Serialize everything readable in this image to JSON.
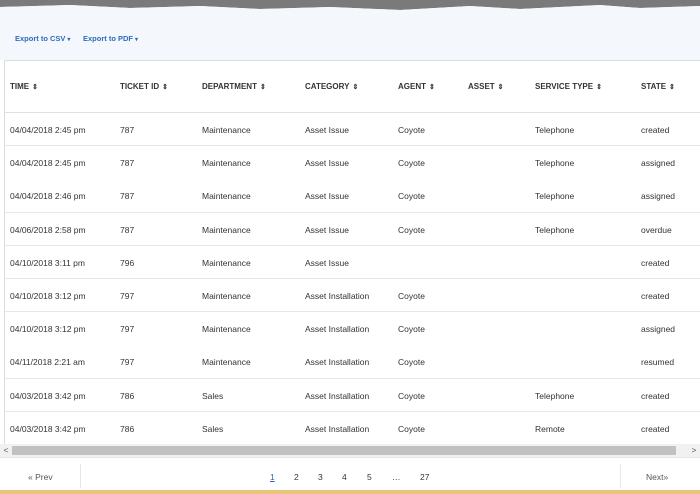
{
  "toolbar": {
    "export_csv": "Export to CSV",
    "export_pdf": "Export to PDF",
    "caret": "▾"
  },
  "columns": [
    {
      "label": "TIME"
    },
    {
      "label": "TICKET ID"
    },
    {
      "label": "DEPARTMENT"
    },
    {
      "label": "CATEGORY"
    },
    {
      "label": "AGENT"
    },
    {
      "label": "ASSET"
    },
    {
      "label": "SERVICE TYPE"
    },
    {
      "label": "STATE"
    }
  ],
  "sort_icon": "⇕",
  "rows": [
    {
      "time": "04/04/2018 2:45 pm",
      "ticket": "787",
      "dept": "Maintenance",
      "category": "Asset Issue",
      "agent": "Coyote",
      "asset": "",
      "service": "Telephone",
      "state": "created"
    },
    {
      "time": "04/04/2018 2:45 pm",
      "ticket": "787",
      "dept": "Maintenance",
      "category": "Asset Issue",
      "agent": "Coyote",
      "asset": "",
      "service": "Telephone",
      "state": "assigned"
    },
    {
      "time": "04/04/2018 2:46 pm",
      "ticket": "787",
      "dept": "Maintenance",
      "category": "Asset Issue",
      "agent": "Coyote",
      "asset": "",
      "service": "Telephone",
      "state": "assigned"
    },
    {
      "time": "04/06/2018 2:58 pm",
      "ticket": "787",
      "dept": "Maintenance",
      "category": "Asset Issue",
      "agent": "Coyote",
      "asset": "",
      "service": "Telephone",
      "state": "overdue"
    },
    {
      "time": "04/10/2018 3:11 pm",
      "ticket": "796",
      "dept": "Maintenance",
      "category": "Asset Issue",
      "agent": "",
      "asset": "",
      "service": "",
      "state": "created"
    },
    {
      "time": "04/10/2018 3:12 pm",
      "ticket": "797",
      "dept": "Maintenance",
      "category": "Asset Installation",
      "agent": "Coyote",
      "asset": "",
      "service": "",
      "state": "created"
    },
    {
      "time": "04/10/2018 3:12 pm",
      "ticket": "797",
      "dept": "Maintenance",
      "category": "Asset Installation",
      "agent": "Coyote",
      "asset": "",
      "service": "",
      "state": "assigned"
    },
    {
      "time": "04/11/2018 2:21 am",
      "ticket": "797",
      "dept": "Maintenance",
      "category": "Asset Installation",
      "agent": "Coyote",
      "asset": "",
      "service": "",
      "state": "resumed"
    },
    {
      "time": "04/03/2018 3:42 pm",
      "ticket": "786",
      "dept": "Sales",
      "category": "Asset Installation",
      "agent": "Coyote",
      "asset": "",
      "service": "Telephone",
      "state": "created"
    },
    {
      "time": "04/03/2018 3:42 pm",
      "ticket": "786",
      "dept": "Sales",
      "category": "Asset Installation",
      "agent": "Coyote",
      "asset": "",
      "service": "Remote",
      "state": "created"
    }
  ],
  "scrollbar": {
    "left_arrow": "<",
    "right_arrow": ">"
  },
  "pagination": {
    "prev": "« Prev",
    "next": "Next»",
    "pages": [
      "1",
      "2",
      "3",
      "4",
      "5",
      "…",
      "27"
    ],
    "current": "1"
  },
  "colors": {
    "accent": "#2d6cc0",
    "toolbar_bg": "#f4f8fc"
  }
}
